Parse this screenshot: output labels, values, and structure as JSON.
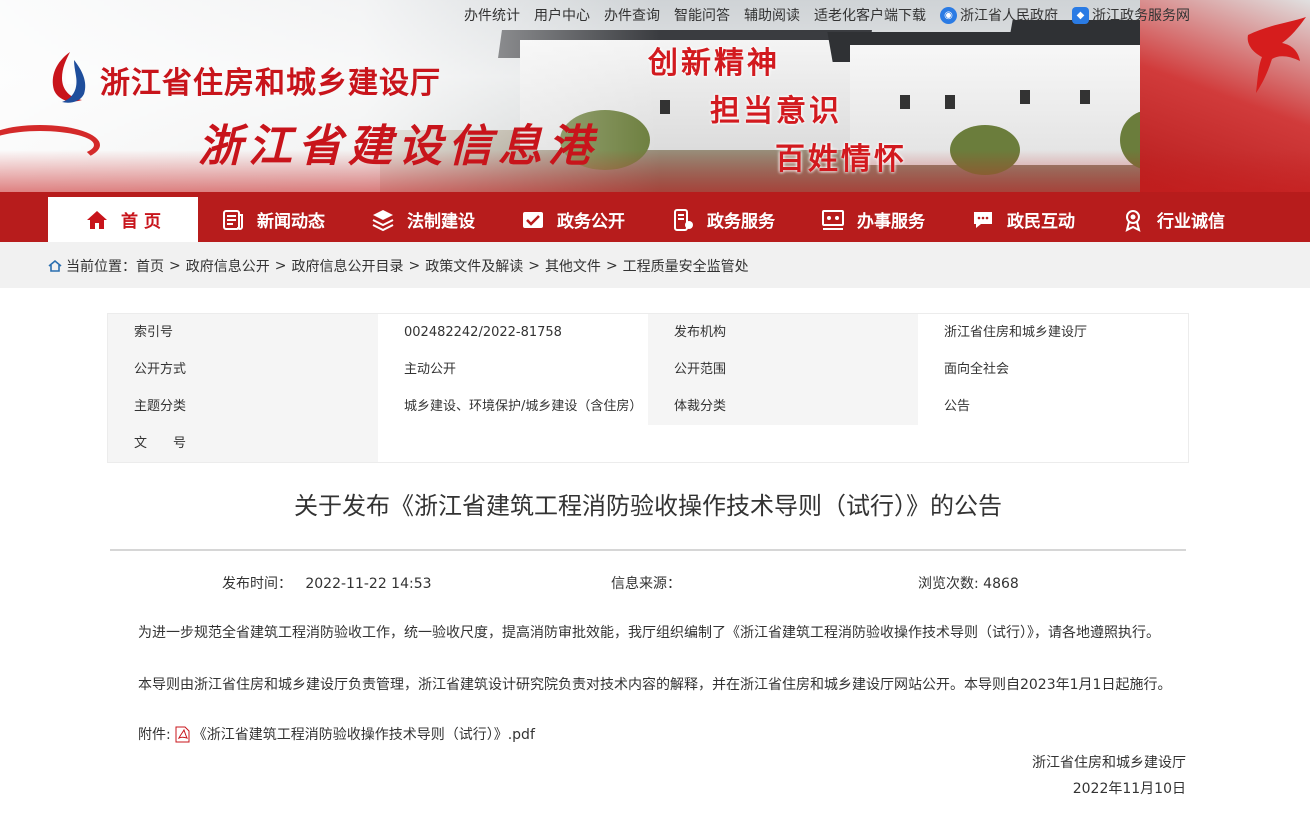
{
  "topbar": {
    "links": [
      "办件统计",
      "用户中心",
      "办件查询",
      "智能问答",
      "辅助阅读",
      "适老化客户端下载"
    ],
    "gov_link": "浙江省人民政府",
    "service_link": "浙江政务服务网"
  },
  "header": {
    "dept_name": "浙江省住房和城乡建设厅",
    "portal_name": "浙江省建设信息港",
    "slogans": [
      "创新精神",
      "担当意识",
      "百姓情怀"
    ]
  },
  "nav": {
    "items": [
      {
        "label": "首 页",
        "icon": "home-icon"
      },
      {
        "label": "新闻动态",
        "icon": "newspaper-icon"
      },
      {
        "label": "法制建设",
        "icon": "layers-icon"
      },
      {
        "label": "政务公开",
        "icon": "document-check-icon"
      },
      {
        "label": "政务服务",
        "icon": "service-icon"
      },
      {
        "label": "办事服务",
        "icon": "people-screen-icon"
      },
      {
        "label": "政民互动",
        "icon": "chat-icon"
      },
      {
        "label": "行业诚信",
        "icon": "award-icon"
      }
    ],
    "active_index": 0
  },
  "breadcrumb": {
    "prefix": "当前位置：",
    "items": [
      "首页",
      "政府信息公开",
      "政府信息公开目录",
      "政策文件及解读",
      "其他文件",
      "工程质量安全监管处"
    ]
  },
  "meta": {
    "index_label": "索引号",
    "index_value": "002482242/2022-81758",
    "publisher_label": "发布机构",
    "publisher_value": "浙江省住房和城乡建设厅",
    "method_label": "公开方式",
    "method_value": "主动公开",
    "scope_label": "公开范围",
    "scope_value": "面向全社会",
    "topic_label": "主题分类",
    "topic_value": "城乡建设、环境保护/城乡建设（含住房）",
    "genre_label": "体裁分类",
    "genre_value": "公告",
    "docno_label": "文　　号",
    "docno_value": ""
  },
  "article": {
    "title": "关于发布《浙江省建筑工程消防验收操作技术导则（试行）》的公告",
    "publish_label": "发布时间：",
    "publish_time": "2022-11-22 14:53",
    "source_label": "信息来源：",
    "source_value": "",
    "views_label": "浏览次数:",
    "views": "4868",
    "paragraphs": [
      "为进一步规范全省建筑工程消防验收工作，统一验收尺度，提高消防审批效能，我厅组织编制了《浙江省建筑工程消防验收操作技术导则（试行）》，请各地遵照执行。",
      "本导则由浙江省住房和城乡建设厅负责管理，浙江省建筑设计研究院负责对技术内容的解释，并在浙江省住房和城乡建设厅网站公开。本导则自2023年1月1日起施行。"
    ],
    "attachment_label": "附件:",
    "attachment_name": "《浙江省建筑工程消防验收操作技术导则（试行）》.pdf",
    "signature_org": "浙江省住房和城乡建设厅",
    "signature_date": "2022年11月10日"
  },
  "colors": {
    "brand_red": "#b71c1c",
    "title_red": "#c8141b",
    "breadcrumb_bg": "#f1f1f1",
    "meta_gray": "#f5f5f5"
  }
}
